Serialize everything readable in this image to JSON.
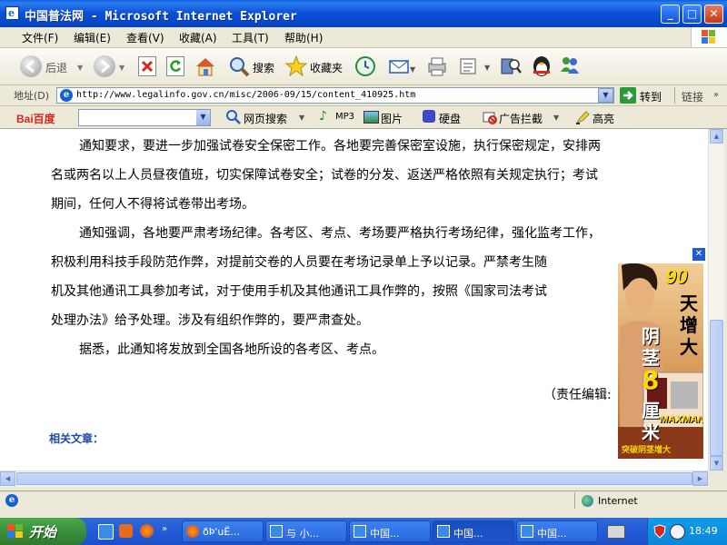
{
  "window": {
    "title": "中国普法网 - Microsoft Internet Explorer",
    "minimize": "_",
    "maximize": "□",
    "close": "✕"
  },
  "menu": [
    "文件(F)",
    "编辑(E)",
    "查看(V)",
    "收藏(A)",
    "工具(T)",
    "帮助(H)"
  ],
  "toolbar": {
    "back": "后退",
    "search": "搜索",
    "favorites": "收藏夹"
  },
  "address": {
    "label": "地址(D)",
    "url": "http://www.legalinfo.gov.cn/misc/2006-09/15/content_410925.htm",
    "go": "转到",
    "links": "链接"
  },
  "baidu_bar": {
    "logo": "Bai百度",
    "web_search": "网页搜索",
    "mp3": "MP3",
    "images": "图片",
    "disk": "硬盘",
    "ad_block": "广告拦截",
    "highlight": "高亮"
  },
  "article": {
    "lines": [
      "通知要求，要进一步加强试卷安全保密工作。各地要完善保密室设施，执行保密规定，安排两",
      "名或两名以上人员昼夜值班，切实保障试卷安全；试卷的分发、返送严格依照有关规定执行；考试",
      "期间，任何人不得将试卷带出考场。",
      "通知强调，各地要严肃考场纪律。各考区、考点、考场要严格执行考场纪律，强化监考工作，",
      "积极利用科技手段防范作弊，对提前交卷的人员要在考场记录单上予以记录。严禁考生随",
      "机及其他通讯工具参加考试，对于使用手机及其他通讯工具作弊的，按照《国家司法考试",
      "处理办法》给予处理。涉及有组织作弊的，要严肃查处。",
      "据悉，此通知将发放到全国各地所设的各考区、考点。"
    ],
    "editor": "（责任编辑:",
    "related": "相关文章："
  },
  "ad": {
    "close": "✕",
    "days": "90",
    "tian": "天",
    "zeng": "增",
    "da": "大",
    "yin": "阴",
    "jing": "茎",
    "eight": "8",
    "li": "厘",
    "mi": "米",
    "brand": "MAXMAN",
    "slogan": "突破阴茎增大"
  },
  "status": {
    "zone": "Internet"
  },
  "taskbar": {
    "start": "开始",
    "tasks": [
      "ðÞ'uË...",
      "与 小...",
      "中国...",
      "中国...",
      "中国..."
    ],
    "active_task": 3,
    "clock": "18:49"
  },
  "colors": {
    "title_blue": "#0a4fd6",
    "related_link": "#1f4aa8",
    "taskbar_blue": "#245edb",
    "start_green": "#3c8f3c"
  }
}
